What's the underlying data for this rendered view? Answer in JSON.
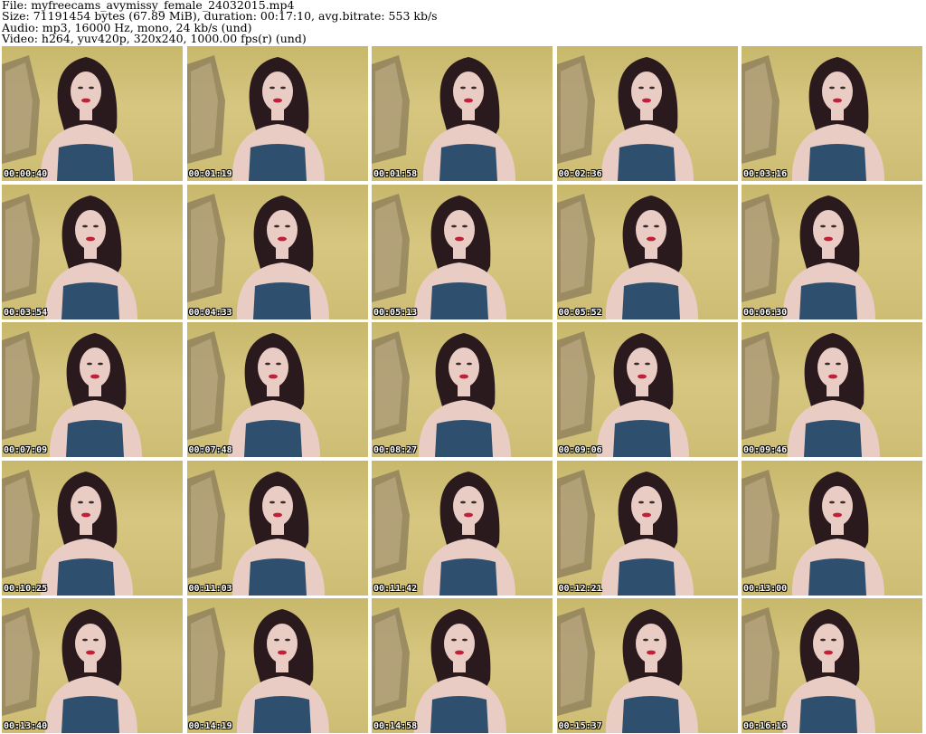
{
  "header": {
    "file": "File: myfreecams_avymissy_female_24032015.mp4",
    "size": "Size: 71191454 bytes (67.89 MiB), duration: 00:17:10, avg.bitrate: 553 kb/s",
    "audio": "Audio: mp3, 16000 Hz, mono, 24 kb/s (und)",
    "video": "Video: h264, yuv420p, 320x240, 1000.00 fps(r) (und)"
  },
  "thumbnails": [
    {
      "timestamp": "00:00:40"
    },
    {
      "timestamp": "00:01:19"
    },
    {
      "timestamp": "00:01:58"
    },
    {
      "timestamp": "00:02:36"
    },
    {
      "timestamp": "00:03:16"
    },
    {
      "timestamp": "00:03:54"
    },
    {
      "timestamp": "00:04:33"
    },
    {
      "timestamp": "00:05:13"
    },
    {
      "timestamp": "00:05:52"
    },
    {
      "timestamp": "00:06:30"
    },
    {
      "timestamp": "00:07:09"
    },
    {
      "timestamp": "00:07:48"
    },
    {
      "timestamp": "00:08:27"
    },
    {
      "timestamp": "00:09:06"
    },
    {
      "timestamp": "00:09:46"
    },
    {
      "timestamp": "00:10:25"
    },
    {
      "timestamp": "00:11:03"
    },
    {
      "timestamp": "00:11:42"
    },
    {
      "timestamp": "00:12:21"
    },
    {
      "timestamp": "00:13:00"
    },
    {
      "timestamp": "00:13:40"
    },
    {
      "timestamp": "00:14:19"
    },
    {
      "timestamp": "00:14:58"
    },
    {
      "timestamp": "00:15:37"
    },
    {
      "timestamp": "00:16:16"
    }
  ],
  "colors": {
    "wall": "#d2c27a",
    "leopard_panel": "#8a7a5a",
    "hair": "#2a1a1e",
    "skin": "#e9cdc4",
    "top": "#2e4f6e",
    "lips": "#c0203a"
  }
}
